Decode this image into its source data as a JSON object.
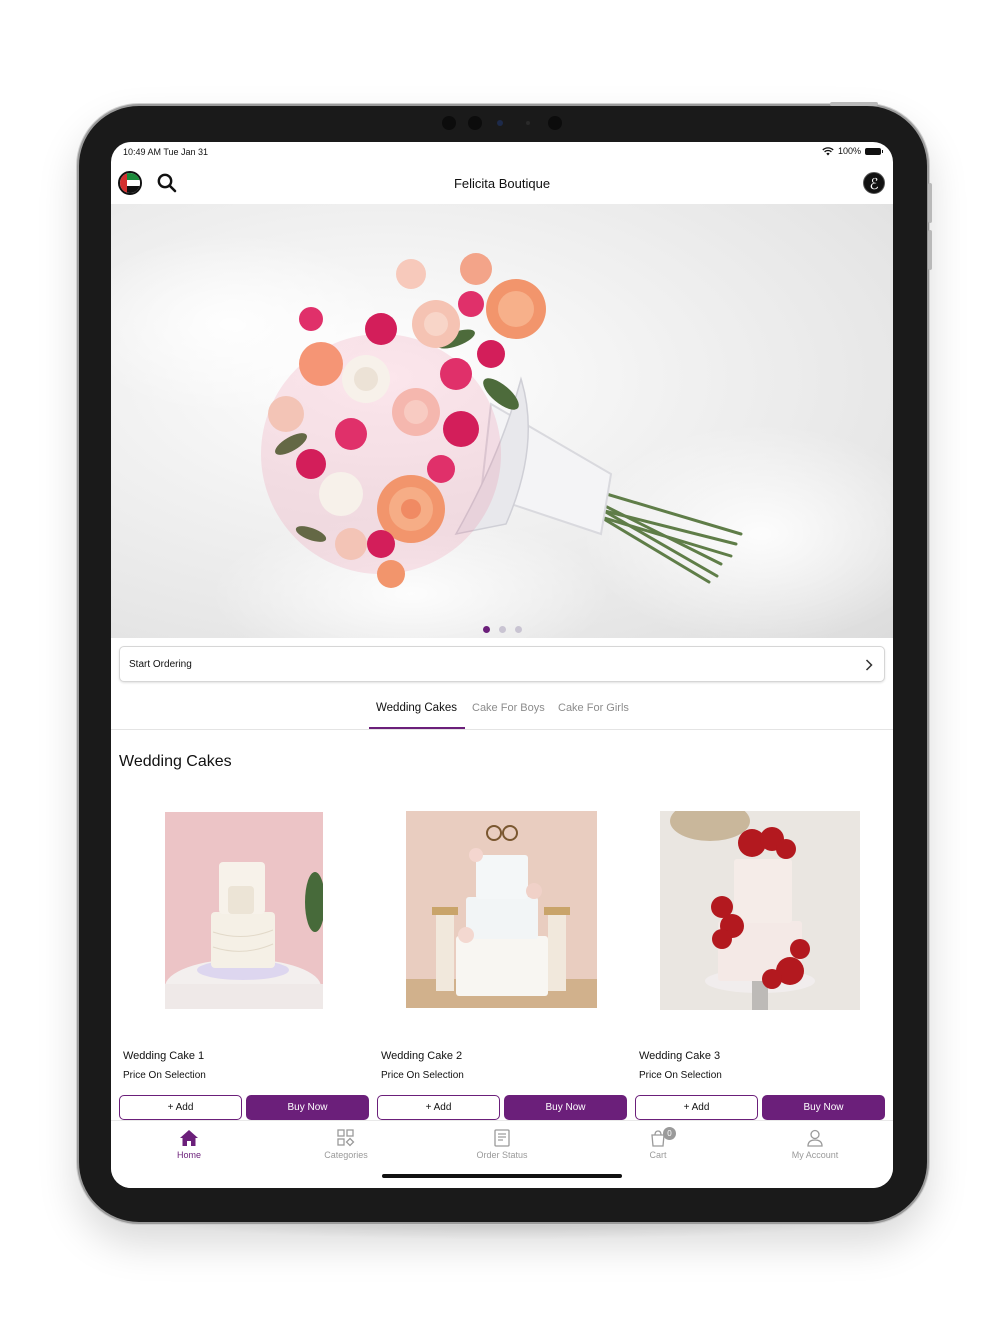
{
  "status_bar": {
    "time": "10:49 AM   Tue Jan 31",
    "battery": "100%"
  },
  "header": {
    "title": "Felicita Boutique",
    "logo_letter": "ℰ"
  },
  "start_ordering": {
    "label": "Start Ordering"
  },
  "tabs": [
    {
      "label": "Wedding Cakes",
      "active": true
    },
    {
      "label": "Cake For Boys",
      "active": false
    },
    {
      "label": "Cake For Girls",
      "active": false
    }
  ],
  "section": {
    "title": "Wedding Cakes"
  },
  "products": [
    {
      "name": "Wedding Cake 1",
      "price": "Price On Selection",
      "add_label": "+ Add",
      "buy_label": "Buy Now"
    },
    {
      "name": "Wedding Cake 2",
      "price": "Price On Selection",
      "add_label": "+ Add",
      "buy_label": "Buy Now"
    },
    {
      "name": "Wedding Cake 3",
      "price": "Price On Selection",
      "add_label": "+ Add",
      "buy_label": "Buy Now"
    }
  ],
  "tab_bar": [
    {
      "label": "Home",
      "icon": "home-icon",
      "active": true
    },
    {
      "label": "Categories",
      "icon": "categories-icon"
    },
    {
      "label": "Order Status",
      "icon": "order-status-icon"
    },
    {
      "label": "Cart",
      "icon": "cart-icon",
      "badge": "0"
    },
    {
      "label": "My Account",
      "icon": "account-icon"
    }
  ],
  "colors": {
    "accent": "#6b1f7a",
    "inactive": "#9a9a9a"
  }
}
